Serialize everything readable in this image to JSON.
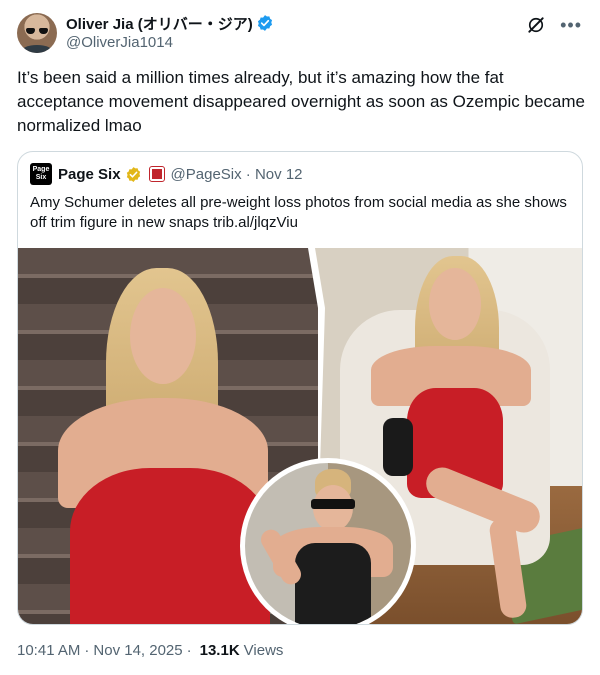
{
  "author": {
    "name": "Oliver Jia (オリバー・ジア)",
    "handle": "@OliverJia1014",
    "icons": {
      "verified": "verified-badge-icon",
      "avatar": "avatar"
    }
  },
  "tweet": {
    "text": "It’s been said a million times already, but it’s amazing how the fat acceptance movement disappeared overnight as soon as Ozempic became normalized lmao"
  },
  "quote": {
    "logo_text": "Page Six",
    "name": "Page Six",
    "handle_date": "@PageSix · Nov 12",
    "text": "Amy Schumer deletes all pre-weight loss photos from social media as she shows off trim figure in new snaps trib.al/jlqzViu"
  },
  "meta": {
    "time": "10:41 AM",
    "date": "Nov 14, 2025",
    "views_count": "13.1K",
    "views_label": "Views",
    "separator": "·"
  },
  "colors": {
    "verified_blue": "#1d9bf0",
    "gold": "#e2b719",
    "secondary_text": "#536471",
    "dress_red": "#c81e26"
  },
  "icons": {
    "grok": "grok-icon",
    "more": "more-icon"
  }
}
